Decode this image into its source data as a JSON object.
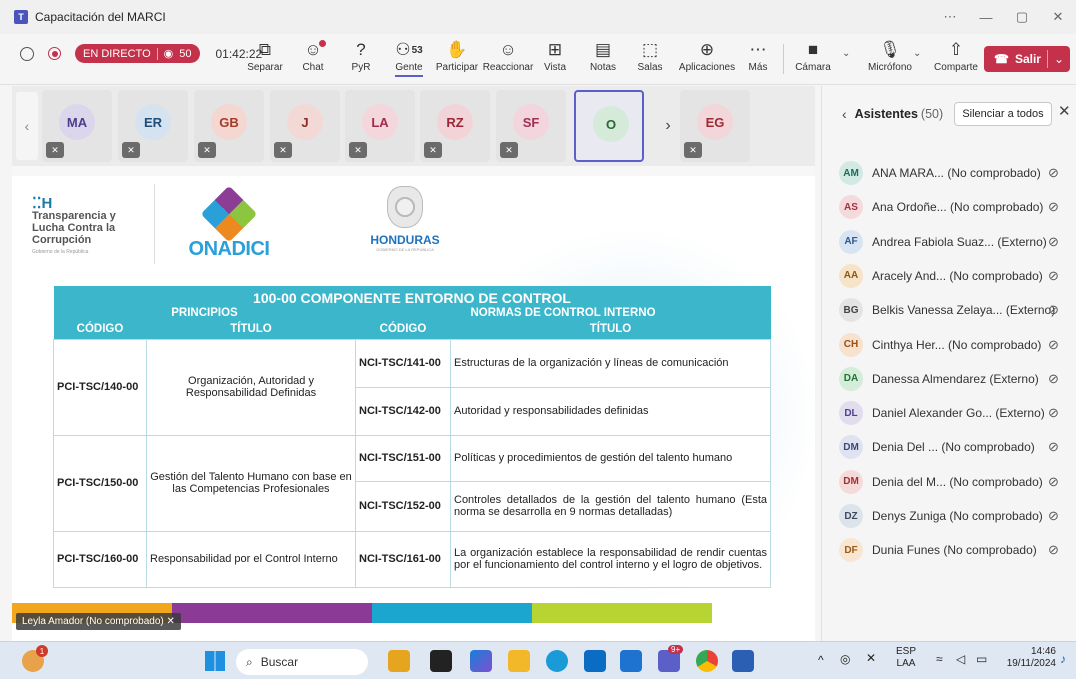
{
  "window": {
    "title": "Capacitación del MARCI",
    "controls": [
      "⋯",
      "—",
      "▢",
      "✕"
    ]
  },
  "toolbar": {
    "live_label": "EN DIRECTO",
    "viewers": "50",
    "timer": "01:42:22",
    "buttons": [
      {
        "name": "pop-out-button",
        "icon": "⧉",
        "label": "Separar"
      },
      {
        "name": "chat-button",
        "icon": "☺",
        "label": "Chat"
      },
      {
        "name": "qa-button",
        "icon": "?",
        "label": "PyR"
      },
      {
        "name": "people-button",
        "icon": "⚇",
        "label": "Gente",
        "badge": "53"
      },
      {
        "name": "raise-hand-button",
        "icon": "✋",
        "label": "Participar"
      },
      {
        "name": "react-button",
        "icon": "☺",
        "label": "Reaccionar"
      },
      {
        "name": "view-button",
        "icon": "⊞",
        "label": "Vista"
      },
      {
        "name": "notes-button",
        "icon": "▤",
        "label": "Notas"
      },
      {
        "name": "rooms-button",
        "icon": "⬚",
        "label": "Salas"
      },
      {
        "name": "apps-button",
        "icon": "⊕",
        "label": "Aplicaciones"
      },
      {
        "name": "more-button",
        "icon": "⋯",
        "label": "Más"
      },
      {
        "name": "camera-button",
        "icon": "■",
        "label": "Cámara"
      },
      {
        "name": "mic-button",
        "icon": "🎙",
        "label": "Micrófono"
      },
      {
        "name": "share-button",
        "icon": "⇧",
        "label": "Comparte"
      }
    ],
    "leave_label": "Salir"
  },
  "video_strip": [
    {
      "initials": "MA",
      "bg": "#dcd6ec",
      "fg": "#4a3f8c"
    },
    {
      "initials": "ER",
      "bg": "#d5e3f0",
      "fg": "#1f4e79"
    },
    {
      "initials": "GB",
      "bg": "#f4d7d1",
      "fg": "#a33b2b"
    },
    {
      "initials": "J",
      "bg": "#f3d9d6",
      "fg": "#8c2d25"
    },
    {
      "initials": "LA",
      "bg": "#f4d6dd",
      "fg": "#a02c4b"
    },
    {
      "initials": "RZ",
      "bg": "#f2d4d8",
      "fg": "#9c2638"
    },
    {
      "initials": "SF",
      "bg": "#f3d5dd",
      "fg": "#a22e55"
    },
    {
      "initials": "O",
      "bg": "#d6ead9",
      "fg": "#25683a"
    },
    {
      "initials": "EG",
      "bg": "#f3d6d9",
      "fg": "#9e2b37"
    }
  ],
  "slide": {
    "logo_th_line1": "Transparencia y",
    "logo_th_line2": "Lucha Contra la",
    "logo_th_line3": "Corrupción",
    "logo_th_small": "Gobierno de la República",
    "logo_onadici": "ONADICI",
    "logo_honduras": "HONDURAS",
    "logo_honduras_sub": "GOBIERNO DE LA REPÚBLICA",
    "table": {
      "title": "100-00 COMPONENTE ENTORNO DE CONTROL",
      "group_left": "PRINCIPIOS",
      "group_right": "NORMAS DE CONTROL INTERNO",
      "col_code": "CÓDIGO",
      "col_title": "TÍTULO",
      "col_code2": "CÓDIGO",
      "col_title2": "TÍTULO",
      "principles": [
        {
          "code": "PCI-TSC/140-00",
          "title": "Organización, Autoridad y Responsabilidad Definidas",
          "norms": [
            {
              "code": "NCI-TSC/141-00",
              "title": "Estructuras de la organización y líneas de comunicación"
            },
            {
              "code": "NCI-TSC/142-00",
              "title": "Autoridad y responsabilidades definidas"
            }
          ]
        },
        {
          "code": "PCI-TSC/150-00",
          "title": "Gestión del Talento Humano con base en las Competencias Profesionales",
          "norms": [
            {
              "code": "NCI-TSC/151-00",
              "title": "Políticas y procedimientos de gestión del talento humano"
            },
            {
              "code": "NCI-TSC/152-00",
              "title": "Controles detallados de la gestión del talento humano (Esta norma se desarrolla en 9 normas detalladas)"
            }
          ]
        },
        {
          "code": "PCI-TSC/160-00",
          "title": "Responsabilidad por el Control Interno",
          "norms": [
            {
              "code": "NCI-TSC/161-00",
              "title": "La organización establece la responsabilidad de rendir cuentas por el funcionamiento del control interno y el logro de objetivos."
            }
          ]
        }
      ]
    },
    "presenter": "Leyla Amador (No comprobado)"
  },
  "panel": {
    "title": "Asistentes",
    "count": "(50)",
    "mute_all": "Silenciar a todos",
    "attendees": [
      {
        "initials": "AM",
        "name": "ANA MARA... (No comprobado)",
        "bg": "#d3e9e3",
        "fg": "#1f6b57"
      },
      {
        "initials": "AS",
        "name": "Ana Ordoñe... (No comprobado)",
        "bg": "#f5dadd",
        "fg": "#a4323e"
      },
      {
        "initials": "AF",
        "name": "Andrea Fabiola Suaz... (Externo)",
        "bg": "#d9e4f2",
        "fg": "#2c5a93"
      },
      {
        "initials": "AA",
        "name": "Aracely And... (No comprobado)",
        "bg": "#f7e3c8",
        "fg": "#8a5a12"
      },
      {
        "initials": "BG",
        "name": "Belkis Vanessa Zelaya... (Externo)",
        "bg": "#e4e4e4",
        "fg": "#444444"
      },
      {
        "initials": "CH",
        "name": "Cinthya Her... (No comprobado)",
        "bg": "#f7e1cf",
        "fg": "#9a4f14"
      },
      {
        "initials": "DA",
        "name": "Danessa Almendarez (Externo)",
        "bg": "#d5ecd9",
        "fg": "#23703b"
      },
      {
        "initials": "DL",
        "name": "Daniel Alexander Go... (Externo)",
        "bg": "#e2dcef",
        "fg": "#4f3f8e"
      },
      {
        "initials": "DM",
        "name": "Denia Del ... (No comprobado)",
        "bg": "#dfe3f0",
        "fg": "#3b4a7a"
      },
      {
        "initials": "DM",
        "name": "Denia del M... (No comprobado)",
        "bg": "#f5dada",
        "fg": "#a33131"
      },
      {
        "initials": "DZ",
        "name": "Denys Zuniga (No comprobado)",
        "bg": "#dde3ea",
        "fg": "#3c4a5a"
      },
      {
        "initials": "DF",
        "name": "Dunia Funes (No comprobado)",
        "bg": "#f8e5d2",
        "fg": "#9a5a18"
      }
    ]
  },
  "taskbar": {
    "search_placeholder": "Buscar",
    "lang": "ESP",
    "lang_sub": "LAA",
    "time": "14:46",
    "date": "19/11/2024",
    "notif_badge": "1",
    "teams_badge": "9+"
  }
}
